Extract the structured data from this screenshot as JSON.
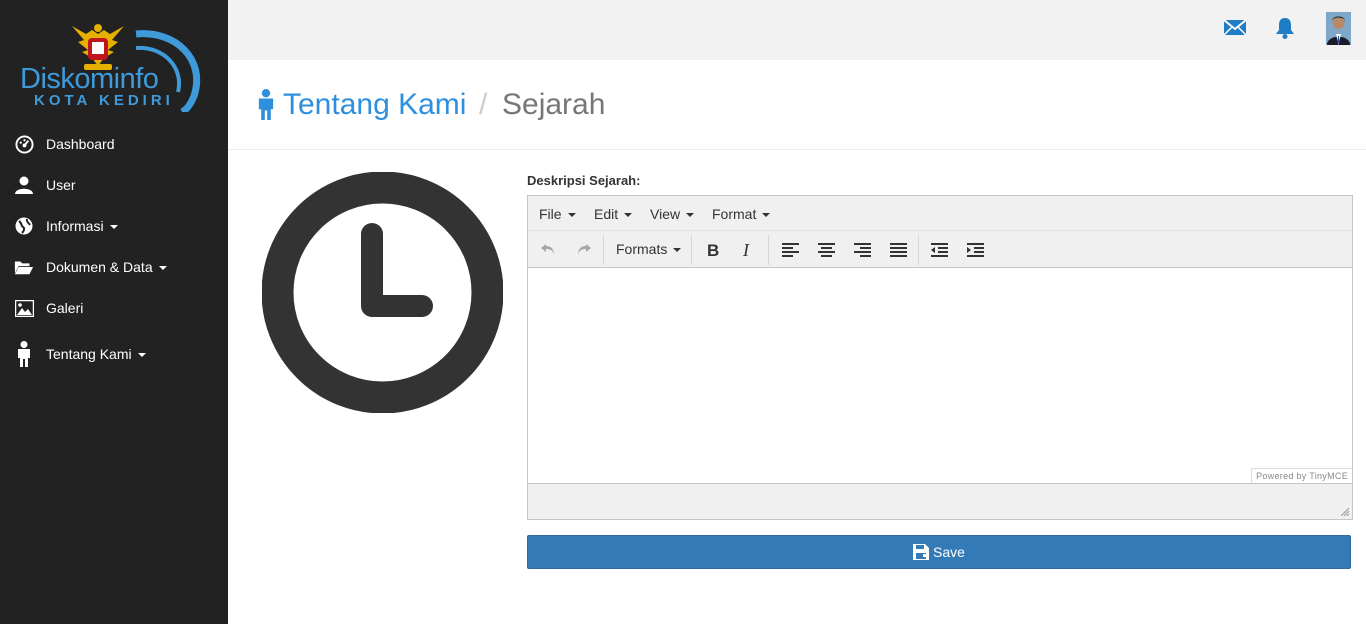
{
  "logo": {
    "brand": "Diskominfo",
    "sub": "KOTA KEDIRI"
  },
  "sidebar": {
    "items": [
      {
        "label": "Dashboard",
        "icon": "dashboard-icon",
        "dropdown": false
      },
      {
        "label": "User",
        "icon": "user-icon",
        "dropdown": false
      },
      {
        "label": "Informasi",
        "icon": "globe-icon",
        "dropdown": true
      },
      {
        "label": "Dokumen & Data",
        "icon": "folder-open-icon",
        "dropdown": true
      },
      {
        "label": "Galeri",
        "icon": "picture-icon",
        "dropdown": false
      },
      {
        "label": "Tentang Kami",
        "icon": "person-icon",
        "dropdown": true
      }
    ]
  },
  "topbar": {
    "icons": [
      "mail-icon",
      "bell-icon",
      "avatar"
    ]
  },
  "header": {
    "title": "Tentang Kami",
    "separator": "/",
    "crumb": "Sejarah"
  },
  "form": {
    "label": "Deskripsi Sejarah:",
    "editor": {
      "menus": [
        "File",
        "Edit",
        "View",
        "Format"
      ],
      "formats_label": "Formats",
      "powered_by": "Powered by TinyMCE",
      "content": ""
    },
    "save_label": "Save"
  },
  "colors": {
    "sidebar_bg": "#222222",
    "accent": "#2e8fde",
    "button": "#337ab7",
    "clock": "#333333"
  }
}
